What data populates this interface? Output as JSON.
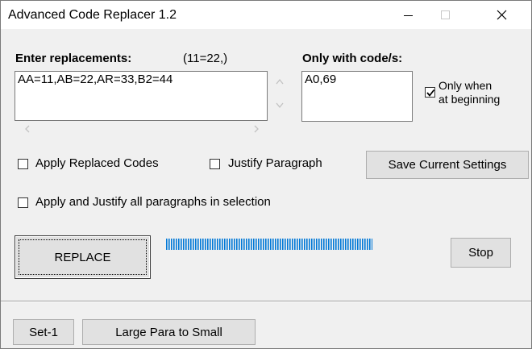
{
  "window": {
    "title": "Advanced Code Replacer  1.2"
  },
  "replacements": {
    "label": "Enter replacements:",
    "hint": "(11=22,)",
    "value": "AA=11,AB=22,AR=33,B2=44"
  },
  "only_codes": {
    "label": "Only with code/s:",
    "value": "A0,69"
  },
  "options": {
    "only_beginning_line1": "Only when",
    "only_beginning_line2": "at beginning",
    "only_beginning_checked": true,
    "apply_replaced_label": "Apply Replaced Codes",
    "apply_replaced_checked": false,
    "justify_label": "Justify Paragraph",
    "justify_checked": false,
    "apply_all_label": "Apply and Justify all paragraphs in selection",
    "apply_all_checked": false
  },
  "buttons": {
    "save_settings": "Save Current Settings",
    "replace": "REPLACE",
    "stop": "Stop",
    "set1": "Set-1",
    "large_para": "Large Para to Small"
  },
  "progress": {
    "value": 1.0
  },
  "icons": {
    "scroll_up": "chevron-up-icon",
    "scroll_down": "chevron-down-icon",
    "scroll_left": "chevron-left-icon",
    "scroll_right": "chevron-right-icon",
    "minimize": "minimize-icon",
    "maximize": "maximize-icon",
    "close": "close-icon",
    "check": "checkmark-icon"
  },
  "colors": {
    "progress": "#0078d7",
    "title_bar": "#ffffff",
    "window_bg": "#f0f0f0"
  }
}
